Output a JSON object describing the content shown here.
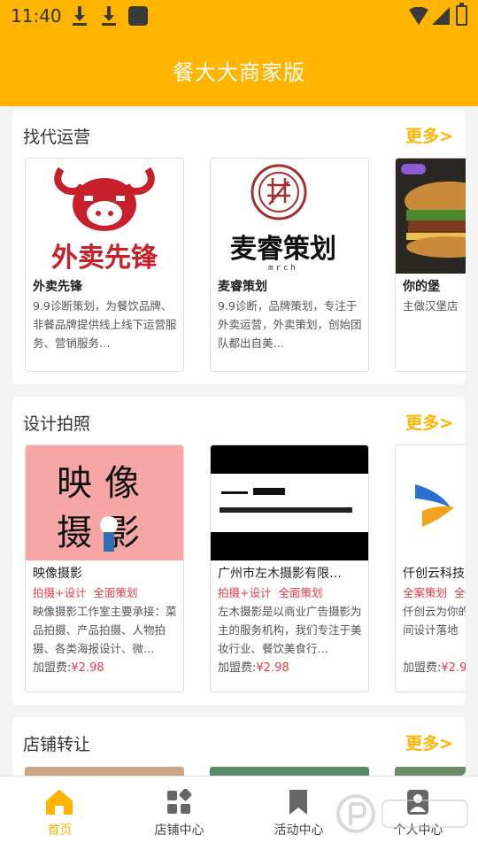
{
  "status": {
    "time": "11:40"
  },
  "app": {
    "title": "餐大大商家版"
  },
  "colors": {
    "accent": "#ffb400",
    "price": "#e8394a"
  },
  "sections": [
    {
      "title": "找代运营",
      "more": "更多>",
      "cards": [
        {
          "logo_text": "外卖先锋",
          "name": "外卖先锋",
          "desc": "9.9诊断策划，为餐饮品牌、非餐品牌提供线上线下运营服务、营销服务…"
        },
        {
          "logo_text": "麦睿策划",
          "logo_sub": "mrch",
          "name": "麦睿策划",
          "desc": "9.9诊断，品牌策划，专注于外卖运营，外卖策划，创始团队都出自美…"
        },
        {
          "logo_text": "",
          "name": "你的堡",
          "desc": "主做汉堡店"
        }
      ]
    },
    {
      "title": "设计拍照",
      "more": "更多>",
      "cards": [
        {
          "logo_text": "映像摄影",
          "name": "映像摄影",
          "tags": [
            "拍摄+设计",
            "全面策划"
          ],
          "desc": "映像摄影工作室主要承接：菜品拍摄、产品拍摄、人物拍摄、各类海报设计、微…",
          "fee_label": "加盟费:",
          "fee_value": "¥2.98"
        },
        {
          "logo_text": "",
          "name": "广州市左木摄影有限…",
          "tags": [
            "拍摄+设计",
            "全面策划"
          ],
          "desc": "左木摄影是以商业广告摄影为主的服务机构，我们专注于美妆行业、餐饮美食行…",
          "fee_label": "加盟费:",
          "fee_value": "¥2.98"
        },
        {
          "logo_text": "",
          "name": "仟创云科技",
          "tags": [
            "全案策划",
            "全"
          ],
          "desc": "仟创云为你的助攻，品牌v空间设计落地",
          "fee_label": "加盟费:",
          "fee_value": "¥2.9"
        }
      ]
    },
    {
      "title": "店铺转让",
      "more": "更多>"
    }
  ],
  "nav": [
    {
      "label": "首页",
      "icon": "home-icon",
      "active": true
    },
    {
      "label": "店铺中心",
      "icon": "grid-icon",
      "active": false
    },
    {
      "label": "活动中心",
      "icon": "bookmark-icon",
      "active": false
    },
    {
      "label": "个人中心",
      "icon": "person-icon",
      "active": false
    }
  ]
}
